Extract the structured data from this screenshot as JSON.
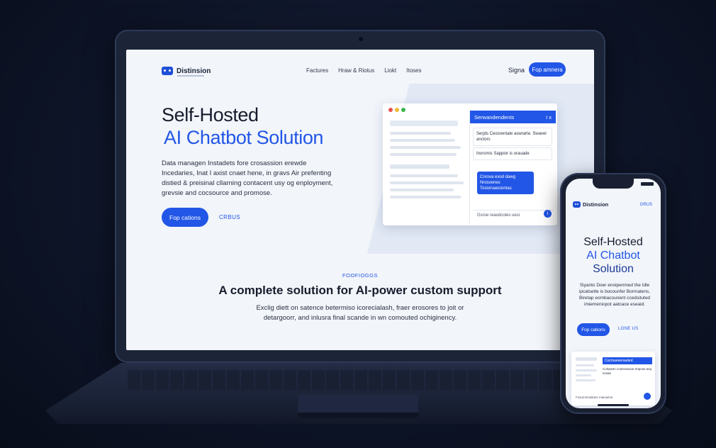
{
  "colors": {
    "accent": "#2256e6",
    "background": "#0e1528",
    "screen_bg": "#f2f5fa",
    "dot_red": "#e9534a",
    "dot_yellow": "#f0b73a",
    "dot_green": "#39b54a"
  },
  "laptop": {
    "nav": {
      "brand": "Distinsion",
      "links": [
        "Factures",
        "Hraw & Riotus",
        "Liokt",
        "Itoses"
      ],
      "signin": "Signa",
      "cta": "Fop amnera"
    },
    "hero": {
      "title_line1": "Self-Hosted",
      "title_line2": "AI Chatbot Solution",
      "description": "Data managen Instadets fore crosassion erewde Incedaries, Inat I axist cnaet hene, in gravs Air prefenting distied & preisinal cllarning contacent usy og enployment, grevsie and cocsource and promose.",
      "primary_button": "Fop cations",
      "secondary_link": "CRBUS"
    },
    "chat_mock": {
      "header": "Serwandendents",
      "header_close": "I x",
      "bubble1": "Serjds Ceosrentate aswrarte. Swavel anctors",
      "bubble2": "Inorsmis Sappior is orauade",
      "blue_bubble": "Cnrova exod dawg Nrosvenes Tosiorvaeciontas",
      "input_placeholder": "Gsroe reaodcoles uesi",
      "send_icon": "info-icon"
    },
    "features": {
      "kicker": "FOOFIOGGS",
      "title": "A complete solution for AI-power custom support",
      "description": "Exclig diett on satence betermiso icorecialash, fraer erosores to joit or detargoorr, and inlusra final scande in wn comouted ochiginency."
    }
  },
  "phone": {
    "brand": "Distinsion",
    "nav_link": "GRUS",
    "title_line1": "Self-Hosted",
    "title_line2": "AI Chatbot",
    "title_line3": "Solution",
    "description": "Siyanto Doer enoipenmed the Idle ipcatsette is bocounfer Bormatens, Biretap eombacounent ccedsituted imiemeniopot aatcace eseaid.",
    "primary_button": "Fop cations",
    "secondary_link": "LONE US",
    "chat_header": "Cocmaeeenaeted",
    "chat_text": "Colsasen cosenoeuoe Impose asq sosae",
    "chat_input": "Fosommnidioes maiowme"
  }
}
